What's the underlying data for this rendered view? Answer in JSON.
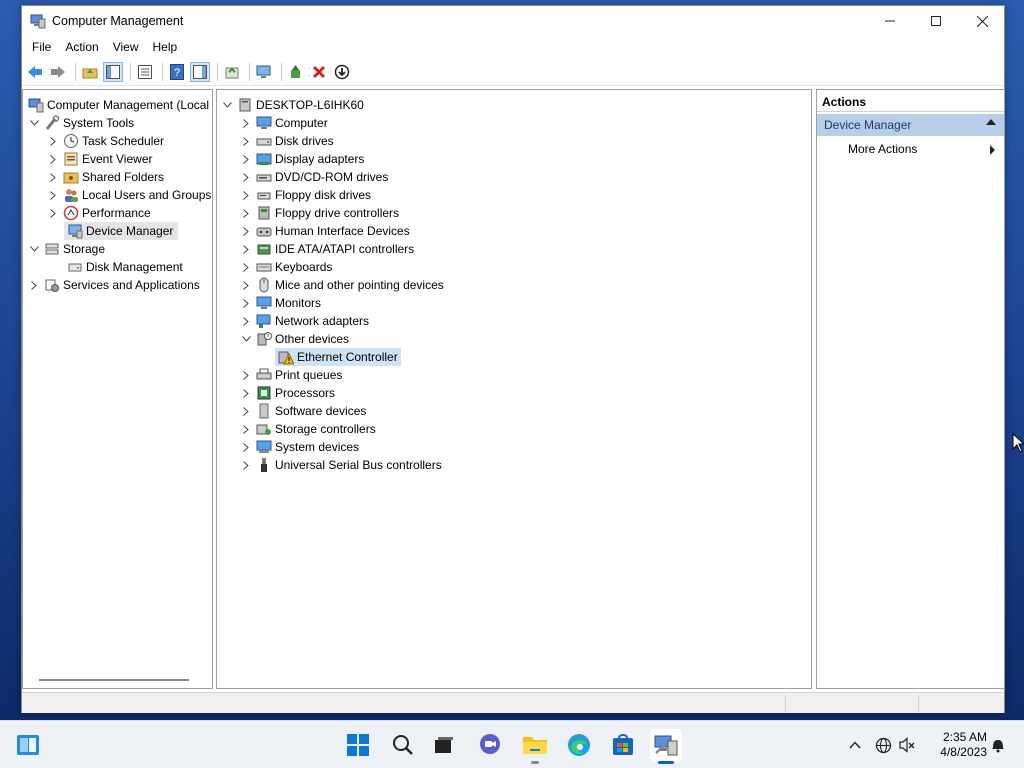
{
  "window": {
    "title": "Computer Management",
    "controls": {
      "minimize": "—",
      "maximize": "☐",
      "close": "✕"
    }
  },
  "menu": [
    "File",
    "Action",
    "View",
    "Help"
  ],
  "toolbar_icons": [
    "back-icon",
    "forward-icon",
    "up-folder-icon",
    "show-hide-console-tree-icon",
    "properties-icon",
    "help-icon",
    "show-hide-action-pane-icon",
    "export-list-icon",
    "scan-hardware-icon",
    "update-driver-icon",
    "uninstall-device-icon",
    "disable-device-icon"
  ],
  "left_tree": {
    "root": "Computer Management (Local",
    "system_tools": "System Tools",
    "task_scheduler": "Task Scheduler",
    "event_viewer": "Event Viewer",
    "shared_folders": "Shared Folders",
    "local_users": "Local Users and Groups",
    "performance": "Performance",
    "device_manager": "Device Manager",
    "storage": "Storage",
    "disk_management": "Disk Management",
    "services": "Services and Applications"
  },
  "device_tree": {
    "root": "DESKTOP-L6IHK60",
    "categories": [
      "Computer",
      "Disk drives",
      "Display adapters",
      "DVD/CD-ROM drives",
      "Floppy disk drives",
      "Floppy drive controllers",
      "Human Interface Devices",
      "IDE ATA/ATAPI controllers",
      "Keyboards",
      "Mice and other pointing devices",
      "Monitors",
      "Network adapters",
      "Other devices",
      "Print queues",
      "Processors",
      "Software devices",
      "Storage controllers",
      "System devices",
      "Universal Serial Bus controllers"
    ],
    "other_devices_child": "Ethernet Controller"
  },
  "actions": {
    "header": "Actions",
    "section": "Device Manager",
    "item": "More Actions"
  },
  "taskbar": {
    "apps": [
      "start-icon",
      "search-icon",
      "task-view-icon",
      "chat-icon",
      "file-explorer-icon",
      "edge-icon",
      "store-icon",
      "computer-management-icon"
    ],
    "tray": [
      "chevron-up-icon",
      "network-icon",
      "volume-muted-icon"
    ],
    "time": "2:35 AM",
    "date": "4/8/2023"
  },
  "colors": {
    "selection": "#cce4f7",
    "actions_section": "#b7cde8",
    "accent": "#0067c0",
    "warning": "#f0c000"
  }
}
